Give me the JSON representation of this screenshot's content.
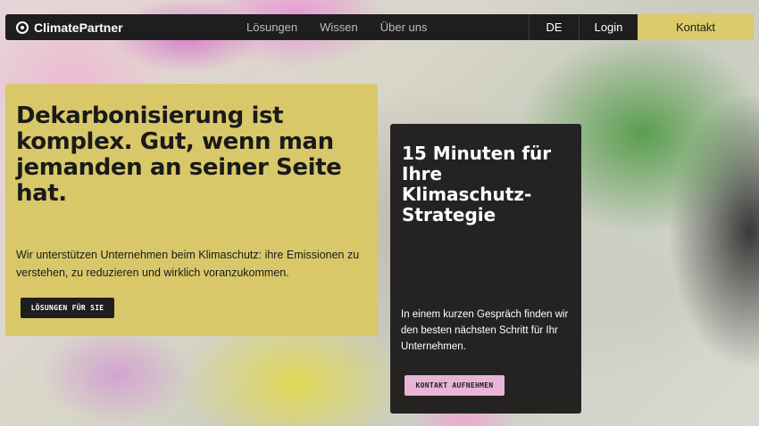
{
  "nav": {
    "logo_text": "ClimatePartner",
    "links": [
      "Lösungen",
      "Wissen",
      "Über uns"
    ],
    "language": "DE",
    "login": "Login",
    "contact": "Kontakt"
  },
  "hero": {
    "title": "Dekarbonisierung ist komplex. Gut, wenn man jemanden an seiner Seite hat.",
    "text": "Wir unterstützen Unternehmen beim Klimaschutz: ihre Emissionen zu verstehen, zu reduzieren und wirklich voranzukommen.",
    "button": "LÖSUNGEN FÜR SIE"
  },
  "card": {
    "title": "15 Minuten für Ihre Klimaschutz-Strategie",
    "text": "In einem kurzen Gespräch finden wir den besten nächsten Schritt für Ihr Unternehmen.",
    "button": "KONTAKT AUFNEHMEN"
  },
  "colors": {
    "nav_bg": "#1e1e1e",
    "accent_yellow": "#d9c869",
    "card_bg": "#242322",
    "accent_pink": "#e8b5d6"
  }
}
